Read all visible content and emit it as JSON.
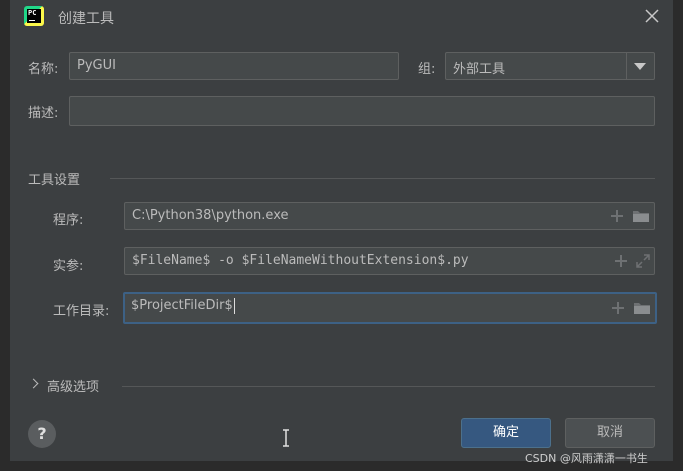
{
  "window": {
    "title": "创建工具",
    "close_icon": "close-icon",
    "app_icon": "pycharm-icon",
    "app_icon_text": "PC"
  },
  "form": {
    "name_label": "名称:",
    "name_value": "PyGUI",
    "group_label": "组:",
    "group_value": "外部工具",
    "description_label": "描述:",
    "description_value": ""
  },
  "tool_settings": {
    "section_title": "工具设置",
    "program_label": "程序:",
    "program_value": "C:\\Python38\\python.exe",
    "arguments_label": "实参:",
    "arguments_value": "$FileName$ -o $FileNameWithoutExtension$.py",
    "workdir_label": "工作目录:",
    "workdir_value": "$ProjectFileDir$"
  },
  "advanced": {
    "label": "高级选项"
  },
  "footer": {
    "help_label": "?",
    "ok_label": "确定",
    "cancel_label": "取消"
  },
  "watermark": "CSDN @风雨潇潇一书生",
  "colors": {
    "background": "#3c3f41",
    "input_bg": "#45494a",
    "focus_border": "#3d6185",
    "primary_button": "#365880"
  }
}
